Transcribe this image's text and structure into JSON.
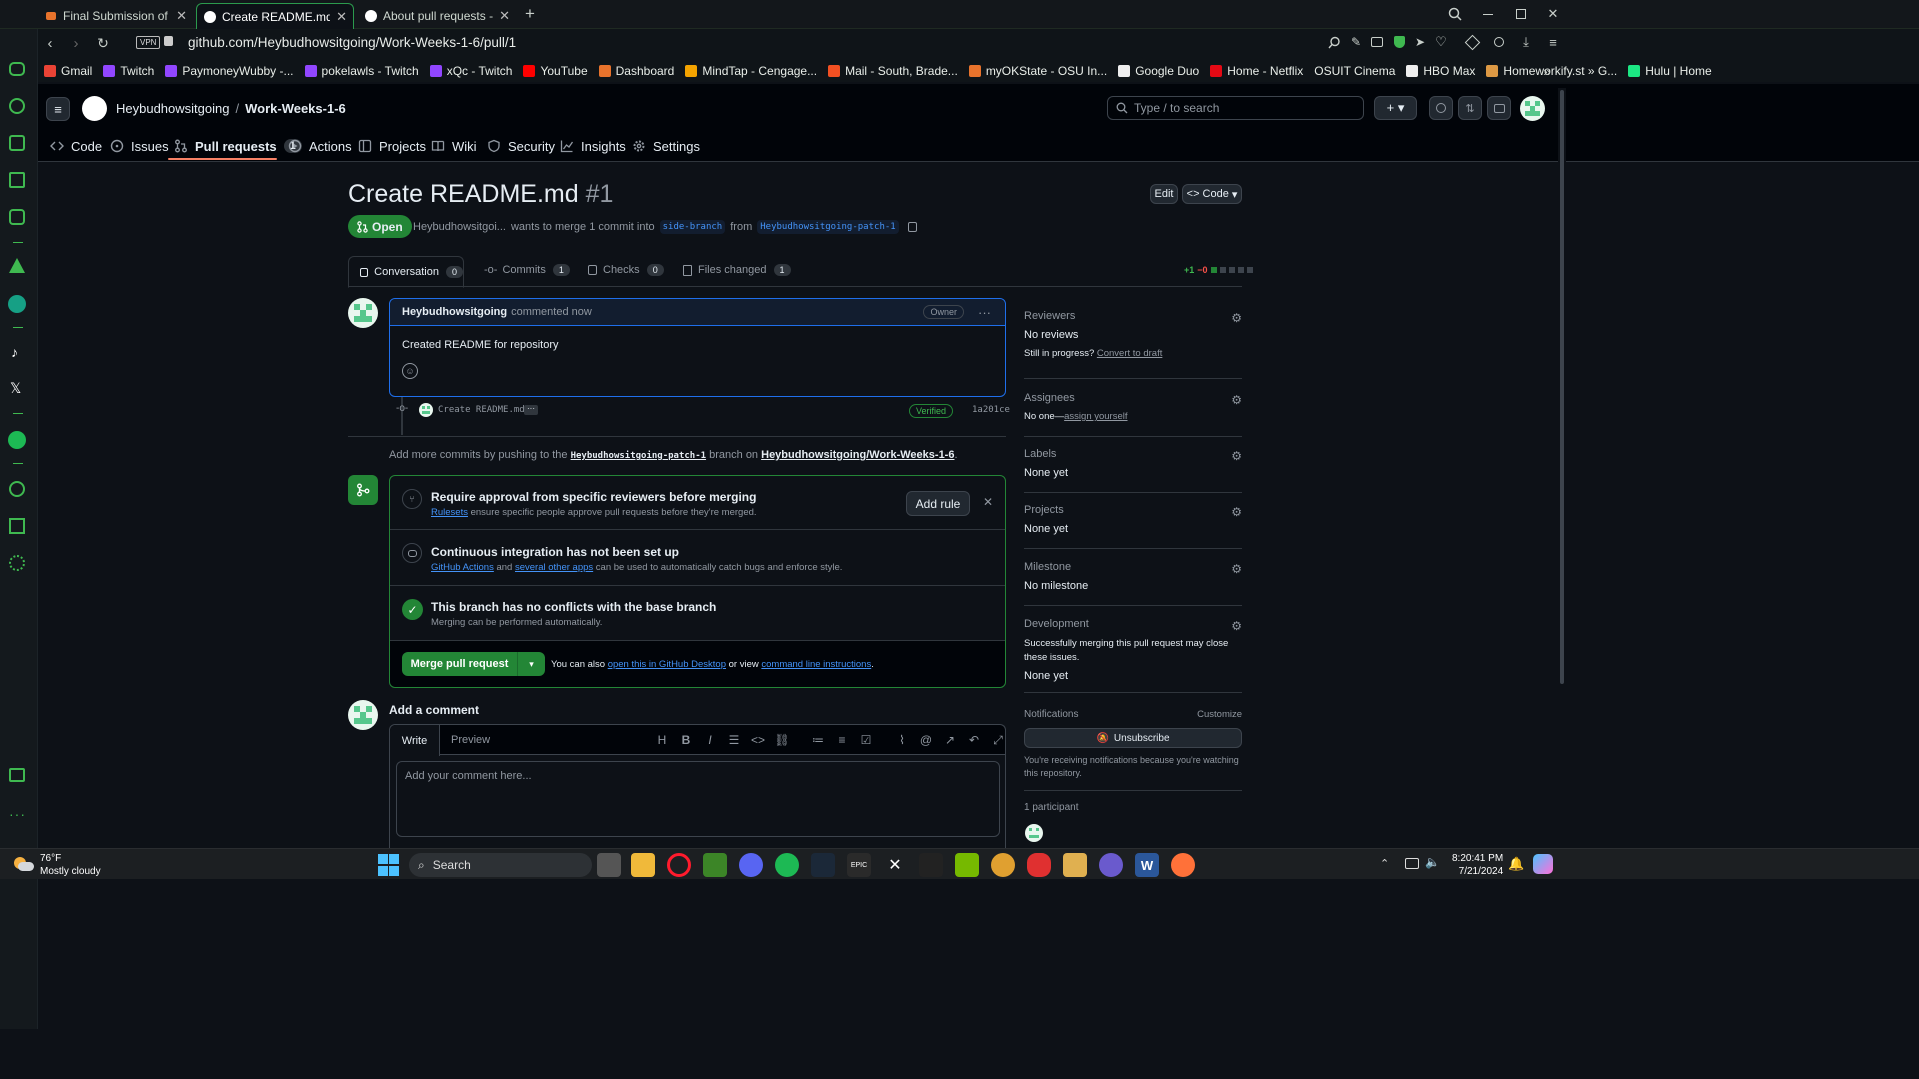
{
  "browser": {
    "tabs": [
      {
        "title": "Final Submission of Project",
        "active": false
      },
      {
        "title": "Create README.md by Hey",
        "active": true
      },
      {
        "title": "About pull requests - GitHu",
        "active": false
      }
    ],
    "url": "github.com/Heybudhowsitgoing/Work-Weeks-1-6/pull/1",
    "vpn_label": "VPN",
    "bookmarks": [
      "Gmail",
      "Twitch",
      "PaymoneyWubby -...",
      "pokelawls - Twitch",
      "xQc - Twitch",
      "YouTube",
      "Dashboard",
      "MindTap - Cengage...",
      "Mail - South, Brade...",
      "myOKState - OSU In...",
      "Google Duo",
      "Home - Netflix",
      "OSUIT Cinema",
      "HBO Max",
      "Homeworkify.st » G...",
      "Hulu | Home"
    ]
  },
  "header": {
    "owner": "Heybudhowsitgoing",
    "separator": "/",
    "repo": "Work-Weeks-1-6",
    "search_placeholder": "Type / to search",
    "nav": [
      {
        "label": "Code",
        "icon": "code-icon"
      },
      {
        "label": "Issues",
        "icon": "issue-icon"
      },
      {
        "label": "Pull requests",
        "icon": "pull-request-icon",
        "count": "1",
        "selected": true
      },
      {
        "label": "Actions",
        "icon": "play-icon"
      },
      {
        "label": "Projects",
        "icon": "table-icon"
      },
      {
        "label": "Wiki",
        "icon": "book-icon"
      },
      {
        "label": "Security",
        "icon": "shield-icon"
      },
      {
        "label": "Insights",
        "icon": "graph-icon"
      },
      {
        "label": "Settings",
        "icon": "gear-icon"
      }
    ]
  },
  "pr": {
    "title": "Create README.md",
    "number": "#1",
    "edit_label": "Edit",
    "code_label": "Code",
    "state": "Open",
    "author_short": "Heybudhowsitgoi...",
    "merge_text": "wants to merge 1 commit into",
    "base_branch": "side-branch",
    "from_text": "from",
    "head_branch": "Heybudhowsitgoing-patch-1",
    "tabs": [
      {
        "label": "Conversation",
        "count": "0"
      },
      {
        "label": "Commits",
        "count": "1"
      },
      {
        "label": "Checks",
        "count": "0"
      },
      {
        "label": "Files changed",
        "count": "1"
      }
    ],
    "diffstat_add": "+1",
    "diffstat_del": "−0"
  },
  "comment": {
    "author": "Heybudhowsitgoing",
    "meta": "commented now",
    "badge": "Owner",
    "body": "Created README for repository"
  },
  "commit": {
    "message": "Create README.md",
    "verified": "Verified",
    "sha": "1a201ce"
  },
  "push_hint": {
    "prefix": "Add more commits by pushing to the",
    "branch": "Heybudhowsitgoing-patch-1",
    "middle": "branch on",
    "repo": "Heybudhowsitgoing/Work-Weeks-1-6",
    "suffix": "."
  },
  "merge_box": {
    "rule_title": "Require approval from specific reviewers before merging",
    "rule_link": "Rulesets",
    "rule_desc": "ensure specific people approve pull requests before they're merged.",
    "add_rule": "Add rule",
    "ci_title": "Continuous integration has not been set up",
    "ci_link1": "GitHub Actions",
    "ci_and": "and",
    "ci_link2": "several other apps",
    "ci_desc": "can be used to automatically catch bugs and enforce style.",
    "conflict_title": "This branch has no conflicts with the base branch",
    "conflict_desc": "Merging can be performed automatically.",
    "merge_button": "Merge pull request",
    "also_text": "You can also",
    "desktop_link": "open this in GitHub Desktop",
    "or_view": "or view",
    "cli_link": "command line instructions",
    "period": "."
  },
  "add_comment": {
    "title": "Add a comment",
    "write_tab": "Write",
    "preview_tab": "Preview",
    "placeholder": "Add your comment here..."
  },
  "sidebar": {
    "reviewers_h": "Reviewers",
    "reviewers_v": "No reviews",
    "in_progress": "Still in progress?",
    "convert_draft": "Convert to draft",
    "assignees_h": "Assignees",
    "assignees_v": "No one—",
    "assign_yourself": "assign yourself",
    "labels_h": "Labels",
    "labels_v": "None yet",
    "projects_h": "Projects",
    "projects_v": "None yet",
    "milestone_h": "Milestone",
    "milestone_v": "No milestone",
    "development_h": "Development",
    "development_v": "Successfully merging this pull request may close these issues.",
    "development_v2": "None yet",
    "notifications_h": "Notifications",
    "customize": "Customize",
    "unsubscribe": "Unsubscribe",
    "notif_desc": "You're receiving notifications because you're watching this repository.",
    "participants": "1 participant"
  },
  "taskbar": {
    "temp": "76°F",
    "weather": "Mostly cloudy",
    "search": "Search",
    "time": "8:20:41 PM",
    "date": "7/21/2024"
  },
  "colors": {
    "accent_green": "#238636",
    "link_blue": "#4493f8",
    "opera_red": "#ff1b2d"
  }
}
